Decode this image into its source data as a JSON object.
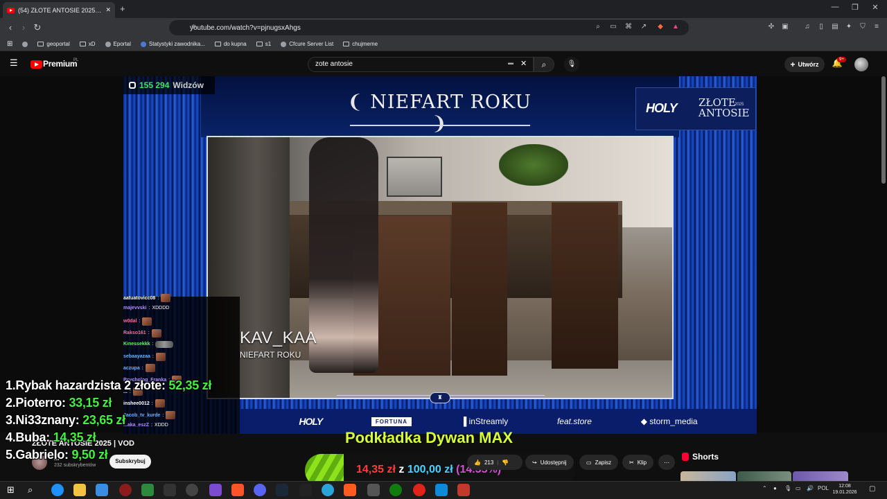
{
  "browser": {
    "tab_title": "(54) ZŁOTE ANTOSIE 2025 | V",
    "url": "youtube.com/watch?v=pjnugsxAhgs",
    "bookmarks": [
      {
        "label": "geoportal",
        "icon": "folder-icon"
      },
      {
        "label": "xD",
        "icon": "folder-icon"
      },
      {
        "label": "Eportal",
        "icon": "site-icon"
      },
      {
        "label": "Statystyki zawodnika...",
        "icon": "site-icon"
      },
      {
        "label": "do kupna",
        "icon": "folder-icon"
      },
      {
        "label": "s1",
        "icon": "folder-icon"
      },
      {
        "label": "Cfcure Server List",
        "icon": "site-icon"
      },
      {
        "label": "chujmeme",
        "icon": "folder-icon"
      }
    ]
  },
  "youtube": {
    "brand": "Premium",
    "brand_sup": "PL",
    "search_value": "zote antosie",
    "create_label": "Utwórz",
    "notif_badge": "9+"
  },
  "stream": {
    "viewer_count": "155 294",
    "viewer_label": "Widzów",
    "award_title": "NIEFART ROKU",
    "event_logo": "HOLY",
    "event_name": "ZŁOTE ANTOSIE",
    "event_year": "2025",
    "nominee_nick": "KAV_KAA",
    "nominee_category": "NIEFART ROKU",
    "sponsors": [
      "HOLY",
      "FORTUNA",
      "inStreamly",
      "feat.store",
      "storm_media"
    ]
  },
  "chat": [
    {
      "user": "aatuatovicc08",
      "color": "#ffffff",
      "msg": "",
      "emote": true
    },
    {
      "user": "majevvski",
      "color": "#b68cff",
      "msg": "XDDDD",
      "emote": false
    },
    {
      "user": "w0dal",
      "color": "#ff6b9a",
      "msg": "",
      "emote": true
    },
    {
      "user": "Rakso161",
      "color": "#ff6b9a",
      "msg": "",
      "emote": true
    },
    {
      "user": "Kinessekkk",
      "color": "#5cff5c",
      "msg": "",
      "emote": true,
      "car": true
    },
    {
      "user": "sebaayazaa",
      "color": "#6bb3ff",
      "msg": "",
      "emote": true
    },
    {
      "user": "aczupa",
      "color": "#6bb3ff",
      "msg": "",
      "emote": true
    },
    {
      "user": "Psycholog_Franka",
      "color": "#b68cff",
      "msg": "",
      "emote": true
    },
    {
      "user": "...",
      "color": "#ffffff",
      "msg": "",
      "emote": true
    },
    {
      "user": "inshee0012",
      "color": "#ffffff",
      "msg": "",
      "emote": true
    },
    {
      "user": "Jacob_tv_kurde",
      "color": "#6bb3ff",
      "msg": "",
      "emote": true
    },
    {
      "user": "...aka_eszZ",
      "color": "#b68cff",
      "msg": "XDDD",
      "emote": false
    }
  ],
  "leaderboard": [
    {
      "rank": "1.",
      "name": "Rybak hazardzista 2 złote:",
      "amount": "52,35 zł"
    },
    {
      "rank": "2.",
      "name": "Pioterro:",
      "amount": "33,15 zł"
    },
    {
      "rank": "3.",
      "name": "Ni33znany:",
      "amount": "23,65 zł"
    },
    {
      "rank": "4.",
      "name": "Buba:",
      "amount": "14,35 zł"
    },
    {
      "rank": "5.",
      "name": "Gabrielo:",
      "amount": "9,50 zł"
    }
  ],
  "goal": {
    "title": "Podkładka Dywan MAX",
    "current": "14,35 zł",
    "of": "z",
    "target": "100,00 zł",
    "percent_label": "(14.35%)",
    "fraction": 0.1435
  },
  "video": {
    "title": "ZŁOTE ANTOSIE 2025 | VOD",
    "channel_name": "...",
    "channel_subs": "232 subskrybentów",
    "subscribe_label": "Subskrybuj",
    "like_count": "213",
    "share_label": "Udostępnij",
    "save_label": "Zapisz",
    "clip_label": "Klip",
    "shorts_label": "Shorts"
  },
  "taskbar": {
    "lang": "POL",
    "time": "12:08",
    "date": "19.01.2026"
  }
}
